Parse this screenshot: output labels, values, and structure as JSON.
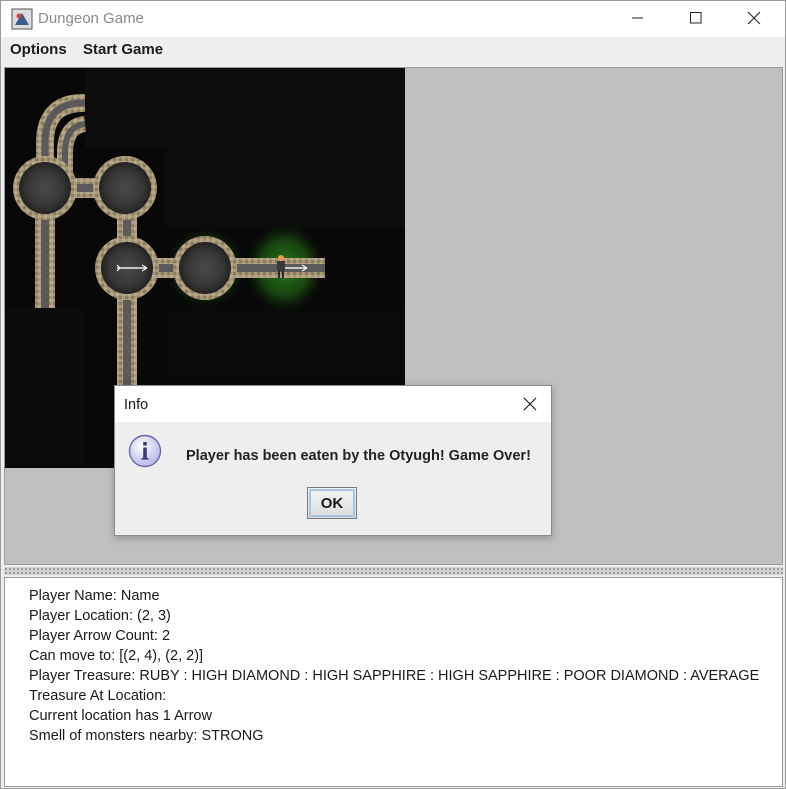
{
  "window": {
    "title": "Dungeon Game",
    "icon": "app-icon"
  },
  "menu": {
    "items": [
      {
        "label": "Options"
      },
      {
        "label": "Start Game"
      }
    ]
  },
  "player_info": {
    "lines": [
      "Player Name: Name",
      "Player Location: (2, 3)",
      "Player Arrow Count: 2",
      "Can move to: [(2, 4), (2, 2)]",
      "Player Treasure: RUBY : HIGH DIAMOND : HIGH SAPPHIRE : HIGH SAPPHIRE : POOR DIAMOND : AVERAGE",
      "Treasure At Location:",
      "Current location has 1 Arrow",
      "Smell of monsters nearby: STRONG"
    ]
  },
  "dialog": {
    "title": "Info",
    "message": "Player has been eaten by the Otyugh! Game Over!",
    "ok_label": "OK",
    "icon": "info-icon"
  },
  "colors": {
    "dungeon_background": "#080808",
    "panel_background": "#c0c0c0",
    "stone": "#a89878",
    "smell_green": "#2f8a1f"
  }
}
